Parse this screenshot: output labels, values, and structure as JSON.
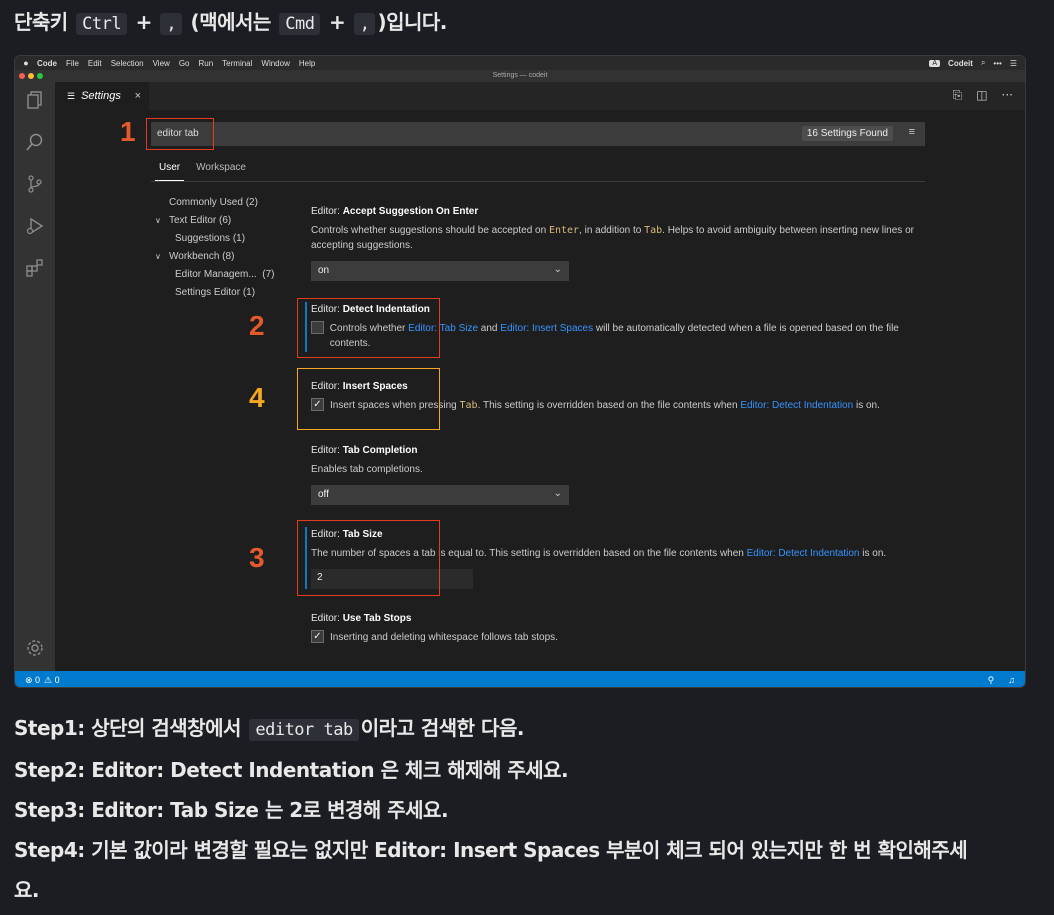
{
  "intro": {
    "prefix": "단축키",
    "key1": "Ctrl",
    "plus": "+",
    "key2": ",",
    "mac_prefix": "(맥에서는",
    "key3": "Cmd",
    "suffix": ")입니다."
  },
  "menubar": {
    "items": [
      "Code",
      "File",
      "Edit",
      "Selection",
      "View",
      "Go",
      "Run",
      "Terminal",
      "Window",
      "Help"
    ],
    "right_badge": "A",
    "right_app": "Codeit"
  },
  "titlebar": {
    "title": "Settings — codeit"
  },
  "tab": {
    "label": "Settings",
    "close": "×"
  },
  "search": {
    "value": "editor tab",
    "found": "16 Settings Found"
  },
  "scope": {
    "user": "User",
    "workspace": "Workspace"
  },
  "toc": [
    "Commonly Used (2)",
    "Text Editor (6)",
    "Suggestions (1)",
    "Workbench (8)",
    "Editor Managem...  (7)",
    "Settings Editor (1)"
  ],
  "settings": {
    "accept": {
      "prefix": "Editor: ",
      "name": "Accept Suggestion On Enter",
      "d1": "Controls whether suggestions should be accepted on ",
      "c1": "Enter",
      "d2": ", in addition to ",
      "c2": "Tab",
      "d3": ". Helps to avoid ambiguity between inserting new lines or accepting suggestions.",
      "value": "on"
    },
    "detect": {
      "prefix": "Editor: ",
      "name": "Detect Indentation",
      "d1": "Controls whether ",
      "l1": "Editor: Tab Size",
      "d2": " and ",
      "l2": "Editor: Insert Spaces",
      "d3": " will be automatically detected when a file is opened based on the file contents.",
      "checked": false
    },
    "insert": {
      "prefix": "Editor: ",
      "name": "Insert Spaces",
      "d1": "Insert spaces when pressing ",
      "c1": "Tab",
      "d2": ". This setting is overridden based on the file contents when ",
      "l1": "Editor: Detect Indentation",
      "d3": " is on.",
      "checked": true
    },
    "completion": {
      "prefix": "Editor: ",
      "name": "Tab Completion",
      "desc": "Enables tab completions.",
      "value": "off"
    },
    "tabsize": {
      "prefix": "Editor: ",
      "name": "Tab Size",
      "d1": "The number of spaces a tab is equal to. This setting is overridden based on the file contents when ",
      "l1": "Editor: Detect Indentation",
      "d2": " is on.",
      "value": "2"
    },
    "tabstops": {
      "prefix": "Editor: ",
      "name": "Use Tab Stops",
      "desc": "Inserting and deleting whitespace follows tab stops.",
      "checked": true
    }
  },
  "status": {
    "errors": "⊗ 0",
    "warnings": "⚠ 0"
  },
  "annotations": {
    "n1": "1",
    "n2": "2",
    "n3": "3",
    "n4": "4"
  },
  "steps": {
    "s1_pre": "Step1: 상단의 검색창에서",
    "s1_code": "editor tab",
    "s1_post": "이라고 검색한 다음.",
    "s2": "Step2: Editor: Detect Indentation 은 체크 해제해 주세요.",
    "s3": "Step3: Editor: Tab Size 는 2로 변경해 주세요.",
    "s4a": "Step4: 기본 값이라 변경할 필요는 없지만 Editor: Insert Spaces 부분이 체크 되어 있는지만 한 번 확인해주세",
    "s4b": "요."
  },
  "colors": {
    "accent": "#007acc",
    "annotation_red": "#e53c20",
    "annotation_yellow": "#f5a623",
    "link": "#3794ff"
  }
}
